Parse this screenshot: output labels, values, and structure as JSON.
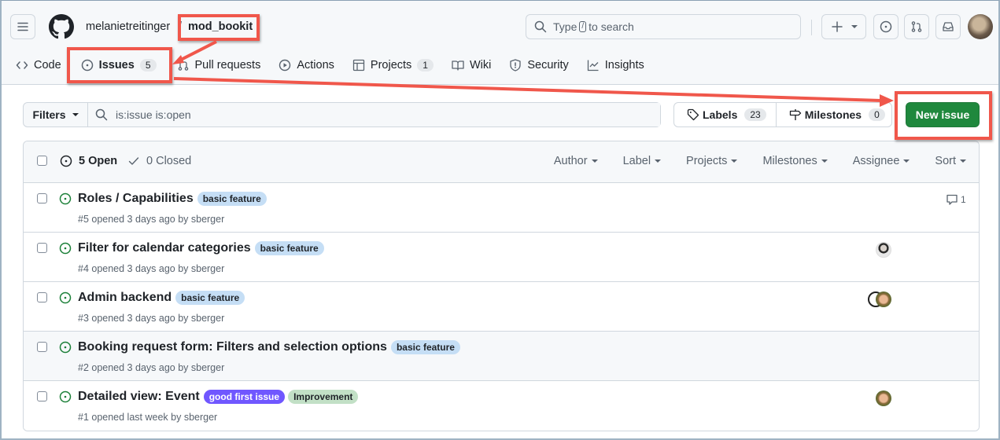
{
  "header": {
    "owner": "melanietreitinger",
    "separator": "/",
    "repo": "mod_bookit",
    "search": {
      "prefix": "Type",
      "key": "/",
      "suffix": "to search"
    },
    "icons": [
      "hamburger-icon",
      "github-logo-icon",
      "plus-icon",
      "issues-icon",
      "pull-request-icon",
      "inbox-icon"
    ]
  },
  "tabs": [
    {
      "label": "Code",
      "icon": "code-icon",
      "active": false
    },
    {
      "label": "Issues",
      "icon": "issue-opened-icon",
      "count": "5",
      "active": true
    },
    {
      "label": "Pull requests",
      "icon": "pull-request-icon",
      "active": false
    },
    {
      "label": "Actions",
      "icon": "play-icon",
      "active": false
    },
    {
      "label": "Projects",
      "icon": "table-icon",
      "count": "1",
      "active": false
    },
    {
      "label": "Wiki",
      "icon": "book-icon",
      "active": false
    },
    {
      "label": "Security",
      "icon": "shield-icon",
      "active": false
    },
    {
      "label": "Insights",
      "icon": "graph-icon",
      "active": false
    }
  ],
  "toolbar": {
    "filters_label": "Filters",
    "filter_query": "is:issue is:open",
    "labels_label": "Labels",
    "labels_count": "23",
    "milestones_label": "Milestones",
    "milestones_count": "0",
    "new_issue_label": "New issue"
  },
  "list_header": {
    "open_label": "5 Open",
    "closed_label": "0 Closed",
    "sorts": [
      "Author",
      "Label",
      "Projects",
      "Milestones",
      "Assignee",
      "Sort"
    ]
  },
  "issues": [
    {
      "title": "Roles / Capabilities",
      "labels": [
        {
          "text": "basic feature",
          "bg": "#c5def5",
          "fg": "#1f2328"
        }
      ],
      "meta": "#5 opened 3 days ago by sberger",
      "comments": "1",
      "assignees": []
    },
    {
      "title": "Filter for calendar categories",
      "labels": [
        {
          "text": "basic feature",
          "bg": "#c5def5",
          "fg": "#1f2328"
        }
      ],
      "meta": "#4 opened 3 days ago by sberger",
      "assignees": [
        "avatar-man"
      ]
    },
    {
      "title": "Admin backend",
      "labels": [
        {
          "text": "basic feature",
          "bg": "#c5def5",
          "fg": "#1f2328"
        }
      ],
      "meta": "#3 opened 3 days ago by sberger",
      "assignees": [
        "avatar-logo",
        "avatar-woman"
      ]
    },
    {
      "title": "Booking request form: Filters and selection options",
      "labels": [
        {
          "text": "basic feature",
          "bg": "#c5def5",
          "fg": "#1f2328"
        }
      ],
      "meta": "#2 opened 3 days ago by sberger",
      "assignees": []
    },
    {
      "title": "Detailed view: Event",
      "labels": [
        {
          "text": "good first issue",
          "bg": "#7057ff",
          "fg": "#ffffff"
        },
        {
          "text": "Improvement",
          "bg": "#c2e0c6",
          "fg": "#1f2328"
        }
      ],
      "meta": "#1 opened last week by sberger",
      "assignees": [
        "avatar-woman"
      ]
    }
  ],
  "colors": {
    "annotation": "#f0574b",
    "primary_button": "#1f883d",
    "open_icon": "#1a7f37"
  }
}
